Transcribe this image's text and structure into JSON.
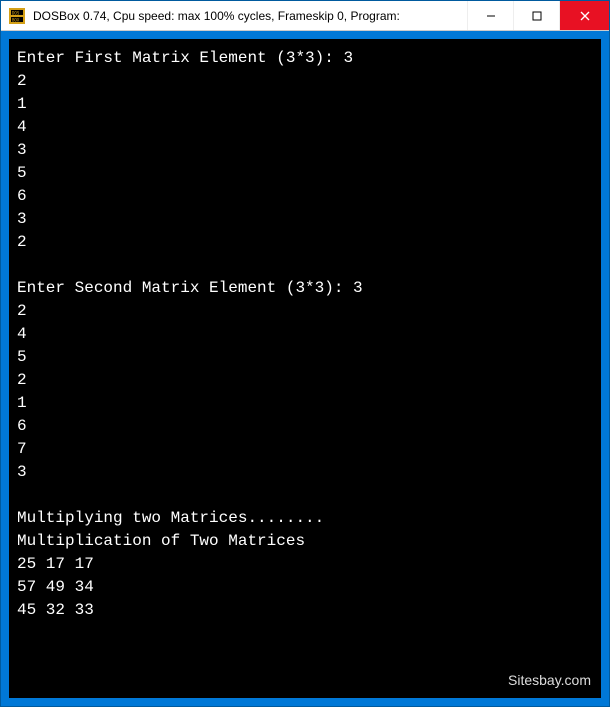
{
  "window": {
    "title": "DOSBox 0.74, Cpu speed: max 100% cycles, Frameskip  0, Program:"
  },
  "console": {
    "prompt1": "Enter First Matrix Element (3*3): 3",
    "matrix1_inputs": [
      "2",
      "1",
      "4",
      "3",
      "5",
      "6",
      "3",
      "2"
    ],
    "prompt2": "Enter Second Matrix Element (3*3): 3",
    "matrix2_inputs": [
      "2",
      "4",
      "5",
      "2",
      "1",
      "6",
      "7",
      "3"
    ],
    "msg_multiplying": "Multiplying two Matrices........",
    "msg_result_header": "Multiplication of Two Matrices",
    "result_rows": [
      "25 17 17",
      "57 49 34",
      "45 32 33"
    ]
  },
  "watermark": "Sitesbay.com"
}
